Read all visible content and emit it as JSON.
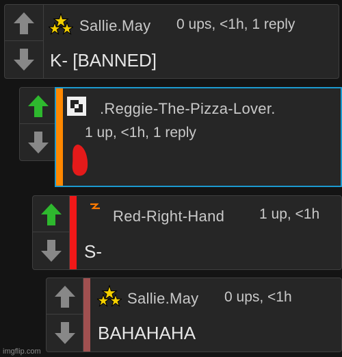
{
  "colors": {
    "background": "#141414",
    "panel": "#262626",
    "arrow_default": "#888888",
    "arrow_upvoted": "#2eb82e",
    "highlight_border": "#1c9ad0",
    "bar_orange": "#ff8800",
    "bar_red": "#f01818",
    "bar_muted": "#a05050",
    "scribble": "#e41a1a"
  },
  "comments": [
    {
      "author": "Sallie.May",
      "meta": "0 ups, <1h, 1 reply",
      "text": "K- [BANNED]",
      "badge_icon": "three-stars-icon",
      "upvoted": false
    },
    {
      "author": ".Reggie-The-Pizza-Lover.",
      "meta": "1 up, <1h, 1 reply",
      "text": "",
      "badge_icon": "square-logo-icon",
      "upvoted": true,
      "bar_color": "#ff8800"
    },
    {
      "author": "Red-Right-Hand",
      "meta": "1 up, <1h",
      "text": "S-",
      "badge_icon": "lightning-icon",
      "upvoted": true,
      "bar_color": "#f01818"
    },
    {
      "author": "Sallie.May",
      "meta": "0 ups, <1h",
      "text": "BAHAHAHA",
      "badge_icon": "three-stars-icon",
      "upvoted": false,
      "bar_color": "#a05050"
    }
  ],
  "watermark": "imgflip.com"
}
